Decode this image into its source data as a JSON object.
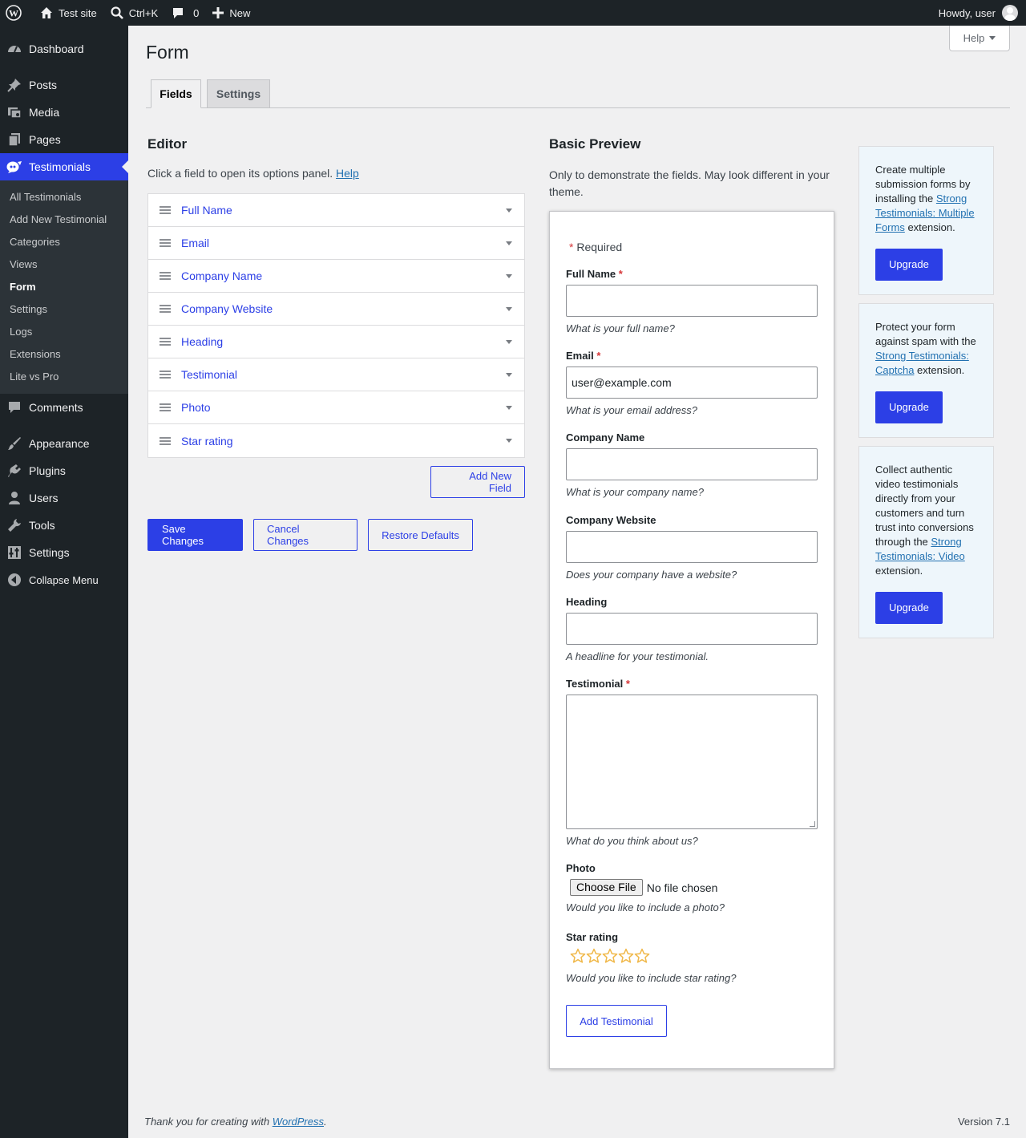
{
  "adminbar": {
    "site": "Test site",
    "search": "Ctrl+K",
    "comments": "0",
    "new": "New",
    "howdy": "Howdy, user"
  },
  "sidebar": {
    "items": [
      {
        "label": "Dashboard",
        "icon": "dashboard-icon"
      },
      {
        "label": "Posts",
        "icon": "pin-icon"
      },
      {
        "label": "Media",
        "icon": "media-icon"
      },
      {
        "label": "Pages",
        "icon": "pages-icon"
      },
      {
        "label": "Testimonials",
        "icon": "testimonials-icon"
      },
      {
        "label": "Comments",
        "icon": "comment-icon"
      },
      {
        "label": "Appearance",
        "icon": "brush-icon"
      },
      {
        "label": "Plugins",
        "icon": "plugin-icon"
      },
      {
        "label": "Users",
        "icon": "user-icon"
      },
      {
        "label": "Tools",
        "icon": "wrench-icon"
      },
      {
        "label": "Settings",
        "icon": "settings-icon"
      },
      {
        "label": "Collapse Menu",
        "icon": "collapse-icon"
      }
    ],
    "submenu": [
      "All Testimonials",
      "Add New Testimonial",
      "Categories",
      "Views",
      "Form",
      "Settings",
      "Logs",
      "Extensions",
      "Lite vs Pro"
    ]
  },
  "help_tab": "Help",
  "page_title": "Form",
  "tabs": [
    "Fields",
    "Settings"
  ],
  "editor": {
    "title": "Editor",
    "intro": "Click a field to open its options panel.",
    "help_link": "Help",
    "fields": [
      "Full Name",
      "Email",
      "Company Name",
      "Company Website",
      "Heading",
      "Testimonial",
      "Photo",
      "Star rating"
    ],
    "add_new_field": "Add New Field",
    "save": "Save Changes",
    "cancel": "Cancel Changes",
    "restore": "Restore Defaults"
  },
  "preview": {
    "title": "Basic Preview",
    "intro": "Only to demonstrate the fields. May look different in your theme.",
    "required_note": "Required",
    "full_name": {
      "label": "Full Name",
      "help": "What is your full name?"
    },
    "email": {
      "label": "Email",
      "value": "user@example.com",
      "help": "What is your email address?"
    },
    "company_name": {
      "label": "Company Name",
      "help": "What is your company name?"
    },
    "company_website": {
      "label": "Company Website",
      "help": "Does your company have a website?"
    },
    "heading": {
      "label": "Heading",
      "help": "A headline for your testimonial."
    },
    "testimonial": {
      "label": "Testimonial",
      "help": "What do you think about us?"
    },
    "photo": {
      "label": "Photo",
      "button": "Choose File",
      "status": "No file chosen",
      "help": "Would you like to include a photo?"
    },
    "star_rating": {
      "label": "Star rating",
      "help": "Would you like to include star rating?"
    },
    "submit": "Add Testimonial"
  },
  "upsells": [
    {
      "pre": "Create multiple submission forms by installing the ",
      "link": "Strong Testimonials: Multiple Forms",
      "post": " extension.",
      "button": "Upgrade"
    },
    {
      "pre": "Protect your form against spam with the ",
      "link": "Strong Testimonials: Captcha",
      "post": " extension.",
      "button": "Upgrade"
    },
    {
      "pre": "Collect authentic video testimonials directly from your customers and turn trust into conversions through the ",
      "link": "Strong Testimonials: Video",
      "post": " extension.",
      "button": "Upgrade"
    }
  ],
  "footer": {
    "thanks_pre": "Thank you for creating with ",
    "thanks_link": "WordPress",
    "thanks_post": ".",
    "version": "Version 7.1"
  },
  "colors": {
    "accent": "#2c3fe6",
    "admin_bg": "#1d2327",
    "required": "#d63638",
    "star": "#f0b849"
  }
}
